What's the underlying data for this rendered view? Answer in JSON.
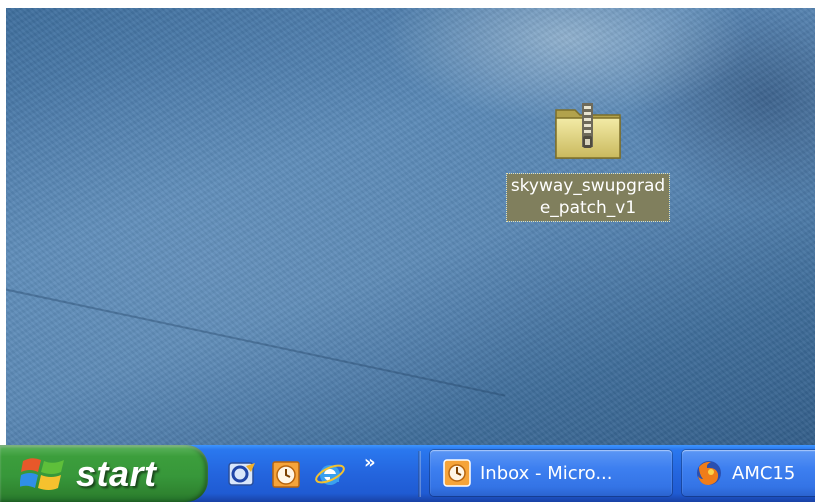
{
  "desktop": {
    "icons": [
      {
        "label": "skyway_swupgrade_patch_v1",
        "icon": "zip-folder-icon"
      }
    ]
  },
  "taskbar": {
    "start_label": "start",
    "quick_launch": [
      {
        "icon": "outlook-express-icon"
      },
      {
        "icon": "calendar-clock-icon"
      },
      {
        "icon": "internet-explorer-icon"
      }
    ],
    "quick_launch_more": "»",
    "tasks": [
      {
        "label": "Inbox - Micro...",
        "icon": "outlook-icon"
      },
      {
        "label": "AMC15",
        "icon": "firefox-icon"
      }
    ]
  },
  "colors": {
    "taskbar_blue": "#2465de",
    "start_green": "#37973a",
    "selection_label_bg": "#807f5d"
  }
}
